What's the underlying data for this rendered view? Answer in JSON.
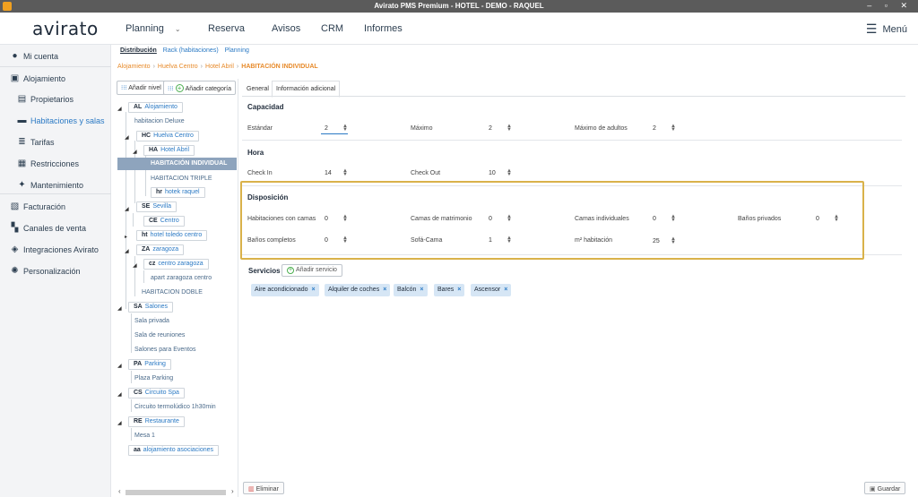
{
  "window": {
    "title": "Avirato PMS Premium - HOTEL - DEMO - RAQUEL",
    "controls": "– ▫ ✕"
  },
  "header": {
    "logo": "avirato",
    "nav": [
      "Planning",
      "Reserva",
      "Avisos",
      "CRM",
      "Informes"
    ],
    "planning_chevron": "⌄",
    "menu_label": "Menú"
  },
  "sidebar": {
    "items": [
      {
        "label": "Mi cuenta",
        "icon": "user-circle-icon"
      },
      {
        "label": "Alojamiento",
        "icon": "building-icon"
      },
      {
        "label": "Propietarios",
        "icon": "id-card-icon"
      },
      {
        "label": "Habitaciones y salas",
        "icon": "bed-icon"
      },
      {
        "label": "Tarifas",
        "icon": "list-icon"
      },
      {
        "label": "Restricciones",
        "icon": "calendar-icon"
      },
      {
        "label": "Mantenimiento",
        "icon": "sparkle-icon"
      },
      {
        "label": "Facturación",
        "icon": "invoice-icon"
      },
      {
        "label": "Canales de venta",
        "icon": "grid-icon"
      },
      {
        "label": "Integraciones Avirato",
        "icon": "stack-icon"
      },
      {
        "label": "Personalización",
        "icon": "gear-icon"
      }
    ]
  },
  "subtabs": [
    "Distribución",
    "Rack (habitaciones)",
    "Planning"
  ],
  "breadcrumb": [
    "Alojamiento",
    "Huelva Centro",
    "Hotel Abril",
    "HABITACIÓN INDIVIDUAL"
  ],
  "tree": {
    "add_level": "Añadir nivel",
    "add_category": "Añadir categoría",
    "nodes": {
      "al": {
        "code": "AL",
        "name": "Alojamiento"
      },
      "hab_deluxe": "habitacion Deluxe",
      "hc": {
        "code": "HC",
        "name": "Huelva Centro"
      },
      "ha": {
        "code": "HA",
        "name": "Hotel Abril"
      },
      "hab_ind": "HABITACIÓN INDIVIDUAL",
      "hab_triple": "HABITACION TRIPLE",
      "hr": {
        "code": "hr",
        "name": "hotek raquel"
      },
      "se": {
        "code": "SE",
        "name": "Sevilla"
      },
      "ce": {
        "code": "CE",
        "name": "Centro"
      },
      "ht": {
        "code": "ht",
        "name": "hotel toledo centro"
      },
      "za": {
        "code": "ZA",
        "name": "zaragoza"
      },
      "cz": {
        "code": "cz",
        "name": "centro zaragoza"
      },
      "apart": "apart zaragoza centro",
      "hab_doble": "HABITACION DOBLE",
      "sa": {
        "code": "SA",
        "name": "Salones"
      },
      "sala_priv": "Sala privada",
      "sala_reun": "Sala de reuniones",
      "salones_ev": "Salones para Eventos",
      "pa": {
        "code": "PA",
        "name": "Parking"
      },
      "plaza": "Plaza Parking",
      "cs": {
        "code": "CS",
        "name": "Circuito Spa"
      },
      "circuito": "Circuito termolúdico 1h30min",
      "re": {
        "code": "RE",
        "name": "Restaurante"
      },
      "mesa": "Mesa 1",
      "aa": {
        "code": "aa",
        "name": "alojamiento asociaciones"
      }
    }
  },
  "detail": {
    "tabs": [
      "General",
      "Información adicional"
    ],
    "capacidad": {
      "title": "Capacidad",
      "estandar_label": "Estándar",
      "estandar": "2",
      "maximo_label": "Máximo",
      "maximo": "2",
      "max_adultos_label": "Máximo de adultos",
      "max_adultos": "2"
    },
    "hora": {
      "title": "Hora",
      "checkin_label": "Check In",
      "checkin": "14",
      "checkout_label": "Check Out",
      "checkout": "10"
    },
    "disposicion": {
      "title": "Disposición",
      "hab_camas_label": "Habitaciones con camas",
      "hab_camas": "0",
      "camas_matr_label": "Camas de matrimonio",
      "camas_matr": "0",
      "camas_ind_label": "Camas individuales",
      "camas_ind": "0",
      "banos_priv_label": "Baños privados",
      "banos_priv": "0",
      "banos_comp_label": "Baños completos",
      "banos_comp": "0",
      "sofa_label": "Sofá-Cama",
      "sofa": "1",
      "m2_label": "m² habitación",
      "m2": "25"
    },
    "servicios": {
      "title": "Servicios",
      "add_label": "Añadir servicio",
      "chips": [
        "Aire acondicionado",
        "Alquiler de coches",
        "Balcón",
        "Bares",
        "Ascensor"
      ]
    },
    "eliminar": "Eliminar",
    "guardar": "Guardar"
  },
  "colors": {
    "accent": "#2a79c4",
    "breadcrumb": "#e78a2a",
    "highlight": "#d9b24a"
  }
}
